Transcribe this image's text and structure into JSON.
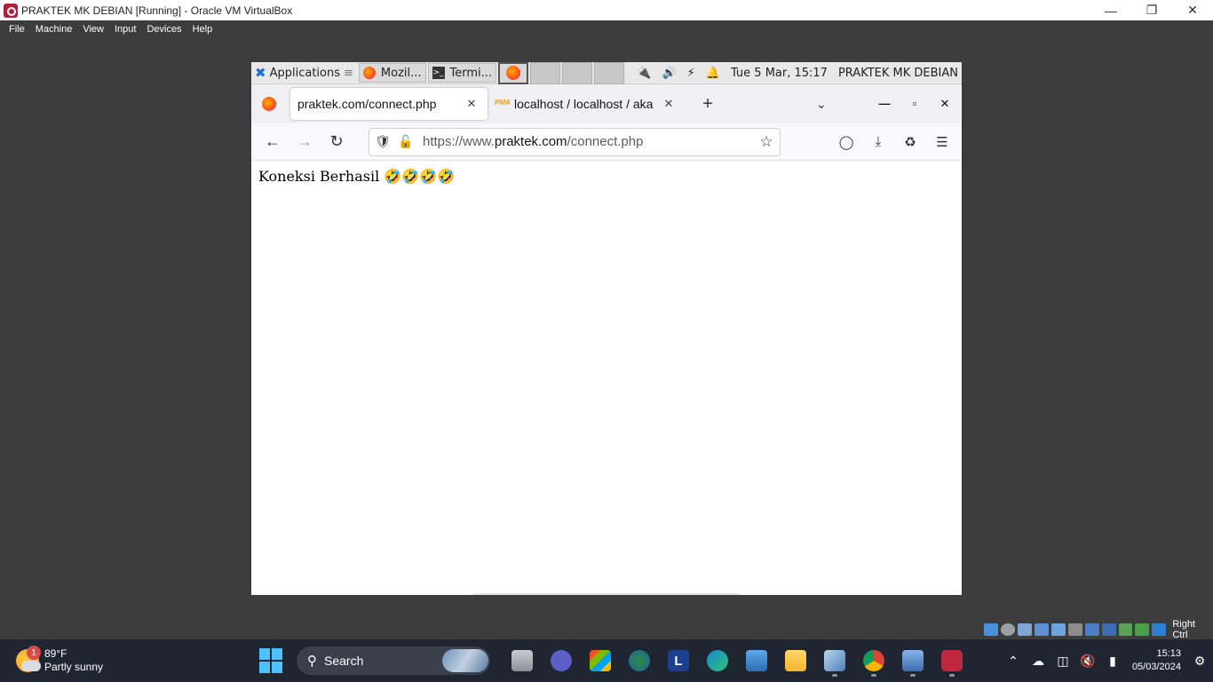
{
  "host": {
    "title": "PRAKTEK MK DEBIAN [Running] - Oracle VM VirtualBox",
    "menu": [
      "File",
      "Machine",
      "View",
      "Input",
      "Devices",
      "Help"
    ],
    "host_key": "Right Ctrl"
  },
  "guest_panel": {
    "applications": "Applications",
    "tasks": [
      "Mozil...",
      "Termi..."
    ],
    "datetime": "Tue  5 Mar, 15:17",
    "hostname": "PRAKTEK MK DEBIAN"
  },
  "firefox": {
    "tabs": [
      {
        "label": "praktek.com/connect.php",
        "active": true
      },
      {
        "label": "localhost / localhost / aka",
        "active": false
      }
    ],
    "url_prefix": "https://www.",
    "url_domain": "praktek.com",
    "url_path": "/connect.php",
    "page_text": "Koneksi Berhasil 🤣🤣🤣🤣"
  },
  "taskbar": {
    "weather_temp": "89°F",
    "weather_desc": "Partly sunny",
    "weather_badge": "1",
    "search_label": "Search",
    "time": "15:13",
    "date": "05/03/2024"
  }
}
